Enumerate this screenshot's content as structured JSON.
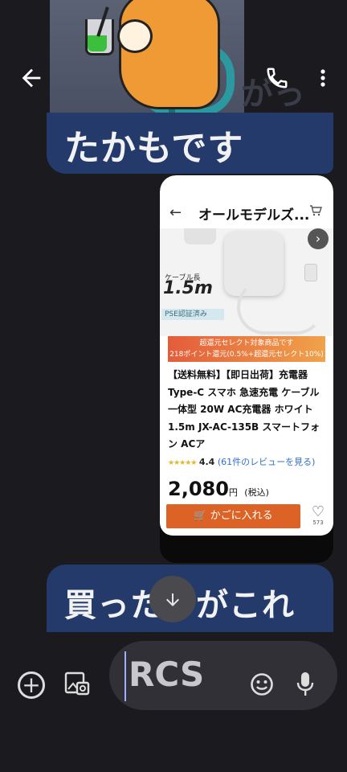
{
  "chat": {
    "faded_header_text": "がっ",
    "message_received_1": "たかもです",
    "message_received_2": "買ったのがこれ"
  },
  "product_card": {
    "title": "オールモデルズ...",
    "image_cable_label": "ケーブル長",
    "image_cable_length": "1.5m",
    "image_badge": "PSE認証済み",
    "promo_line1": "超還元セレクト対象商品です",
    "promo_line2": "218ポイント還元(0.5%+超還元セレクト10%)",
    "product_name": "【送料無料】【即日出荷】充電器 Type-C スマホ 急速充電 ケーブル 一体型 20W AC充電器 ホワイト 1.5m JX-AC-135B スマートフォン ACア",
    "rating_stars": "★★★★★",
    "rating_value": "4.4",
    "review_link": "(61件のレビューを見る)",
    "price": "2,080",
    "price_unit": "円",
    "price_tax": "(税込)",
    "cart_button": "かごに入れる",
    "like_count": "573"
  },
  "composer": {
    "input_text": "RCS"
  },
  "icons": {
    "back": "arrow-left-icon",
    "call": "phone-icon",
    "menu": "more-vert-icon",
    "scroll": "arrow-down-icon",
    "add": "plus-circle-icon",
    "gallery": "gallery-icon",
    "emoji": "emoji-icon",
    "mic": "mic-icon"
  },
  "colors": {
    "bubble": "#233a6b",
    "cart_button": "#dd6226",
    "background": "#1b1b1f"
  }
}
